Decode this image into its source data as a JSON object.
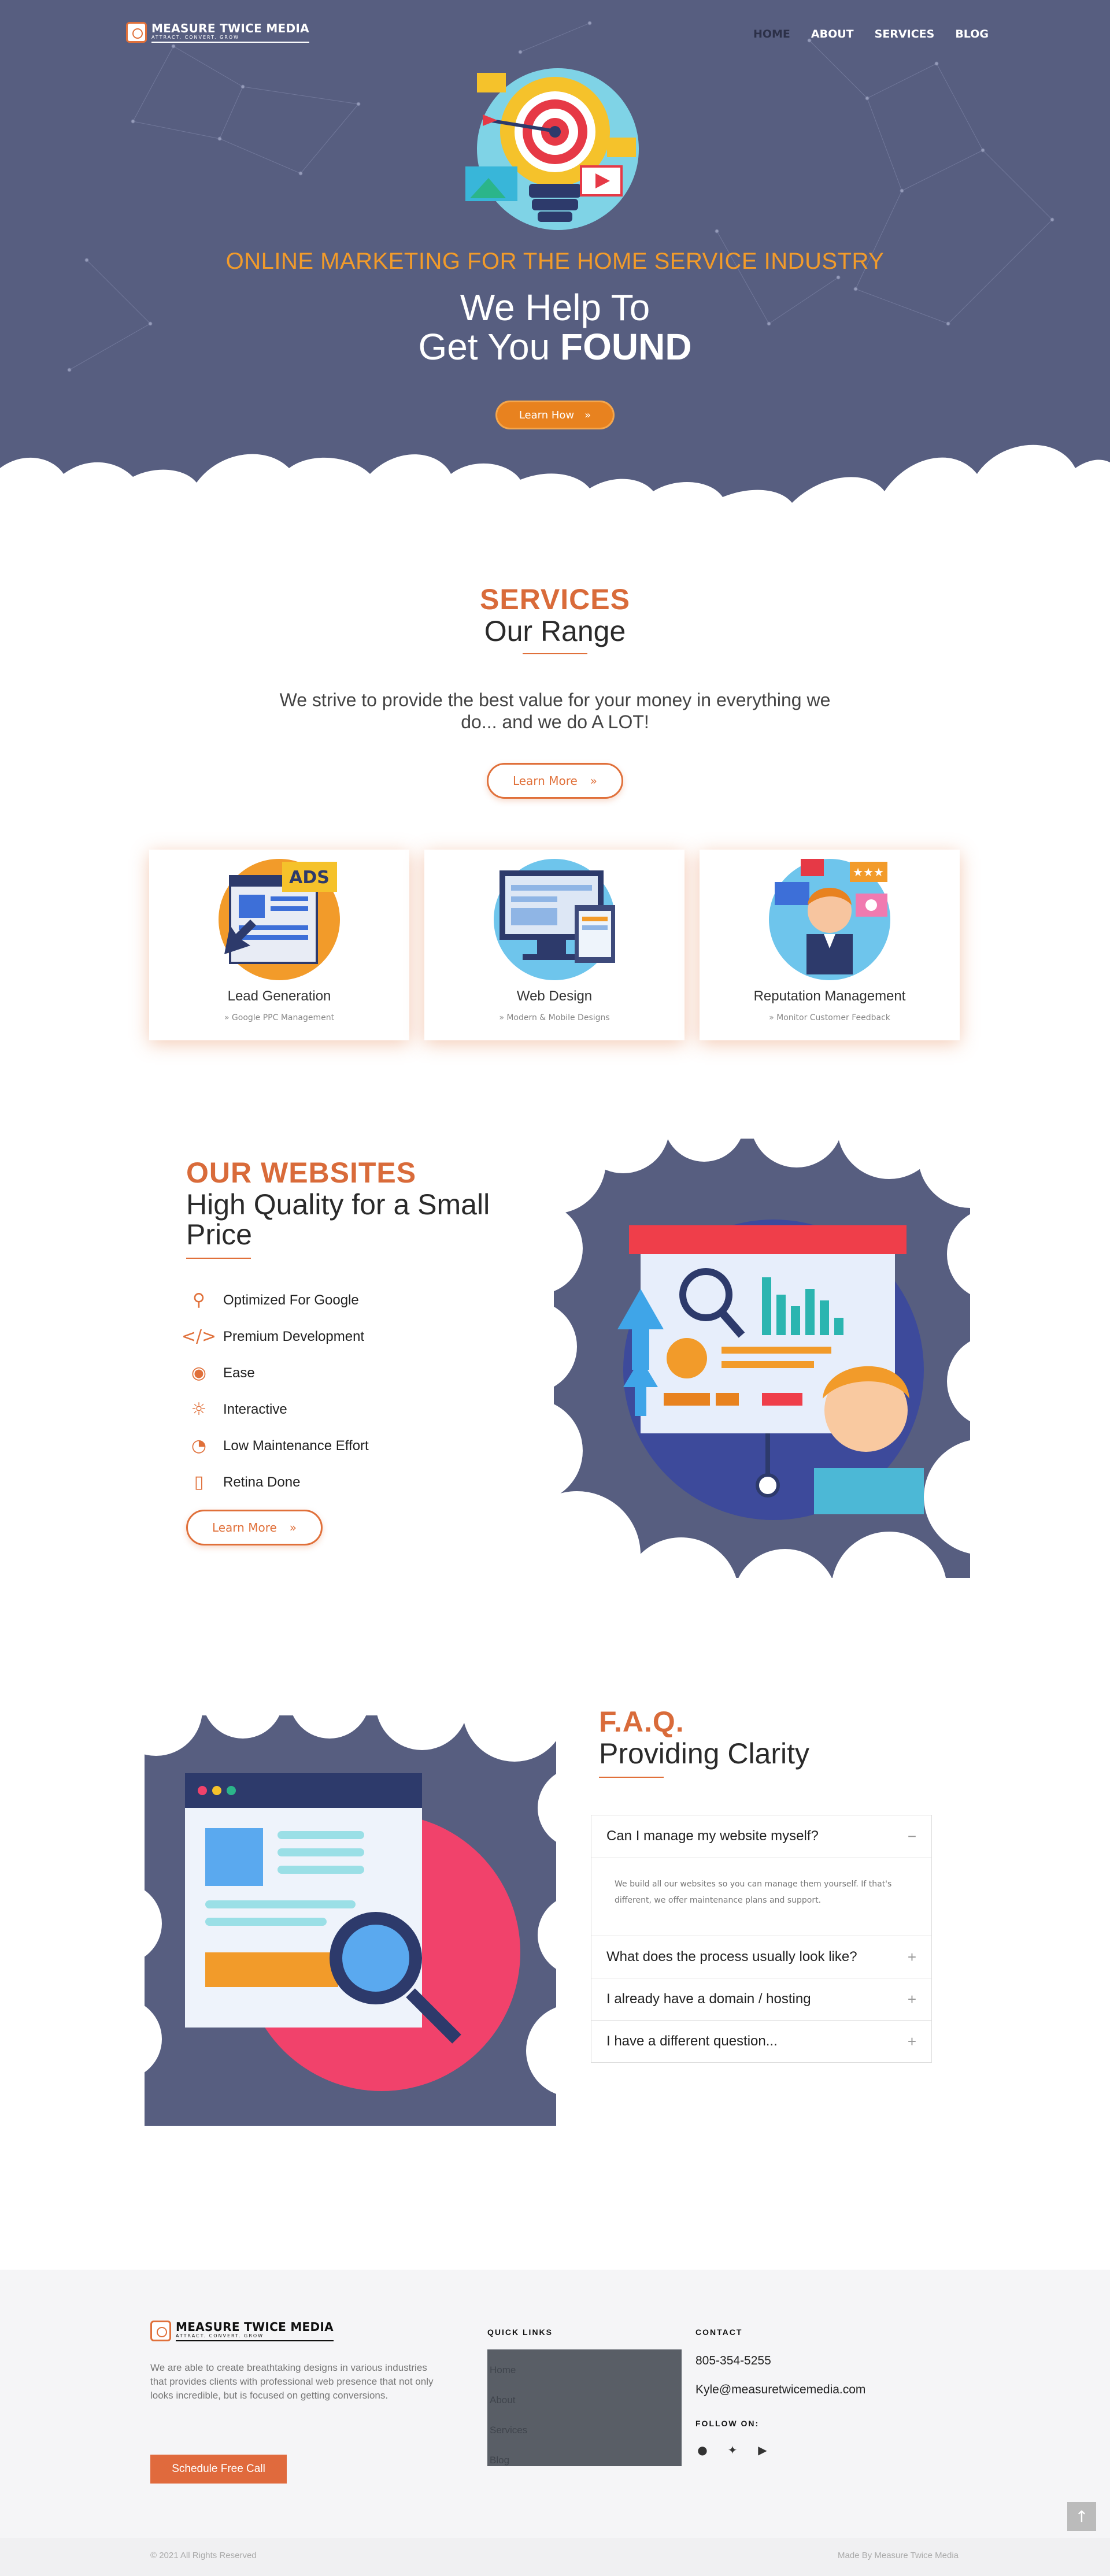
{
  "brand": {
    "name": "MEASURE TWICE MEDIA",
    "tagline": "ATTRACT. CONVERT. GROW"
  },
  "nav": {
    "items": [
      "HOME",
      "ABOUT",
      "SERVICES",
      "BLOG"
    ]
  },
  "hero": {
    "kicker": "ONLINE MARKETING FOR THE HOME SERVICE INDUSTRY",
    "line1": "We Help To",
    "line2_pre": "Get You ",
    "line2_bold": "FOUND",
    "button": "Learn How"
  },
  "services": {
    "kicker": "SERVICES",
    "title": "Our Range",
    "desc": "We strive to provide the best value for your money in everything we do... and we do A LOT!",
    "button": "Learn More",
    "cards": [
      {
        "title": "Lead Generation",
        "sub": "» Google PPC Management"
      },
      {
        "title": "Web Design",
        "sub": "» Modern & Mobile Designs"
      },
      {
        "title": "Reputation Management",
        "sub": "» Monitor Customer Feedback"
      }
    ]
  },
  "websites": {
    "kicker": "OUR WEBSITES",
    "title": "High Quality for a Small Price",
    "features": [
      {
        "icon": "search-icon",
        "label": "Optimized For Google"
      },
      {
        "icon": "code-icon",
        "label": "Premium Development"
      },
      {
        "icon": "gamepad-icon",
        "label": "Ease"
      },
      {
        "icon": "compass-icon",
        "label": "Interactive"
      },
      {
        "icon": "gauge-icon",
        "label": "Low Maintenance Effort"
      },
      {
        "icon": "mobile-icon",
        "label": "Retina Done"
      }
    ],
    "button": "Learn More"
  },
  "faq": {
    "kicker": "F.A.Q.",
    "title": "Providing Clarity",
    "items": [
      {
        "q": "Can I manage my website myself?",
        "a": "We build all our websites so you can manage them yourself. If that's different, we offer maintenance plans and support.",
        "open": true
      },
      {
        "q": "What does the process usually look like?",
        "open": false
      },
      {
        "q": "I already have a domain / hosting",
        "open": false
      },
      {
        "q": "I have a different question...",
        "open": false
      }
    ]
  },
  "footer": {
    "about": "We are able to create breathtaking designs in various industries that provides clients with professional web presence that not only looks incredible, but is focused on getting conversions.",
    "cta": "Schedule Free Call",
    "links_heading": "QUICK LINKS",
    "links": [
      "Home",
      "About",
      "Services",
      "Blog"
    ],
    "contact_heading": "CONTACT",
    "phone": "805-354-5255",
    "email": "Kyle@measuretwicemedia.com",
    "follow_heading": "FOLLOW ON:",
    "socials": [
      "facebook-icon",
      "twitter-icon",
      "youtube-icon"
    ],
    "copyright": "© 2021 All Rights Reserved",
    "madeby": "Made By Measure Twice Media"
  },
  "colors": {
    "hero_bg": "#575e80",
    "accent": "#e0703a",
    "kicker": "#f29b2a"
  }
}
